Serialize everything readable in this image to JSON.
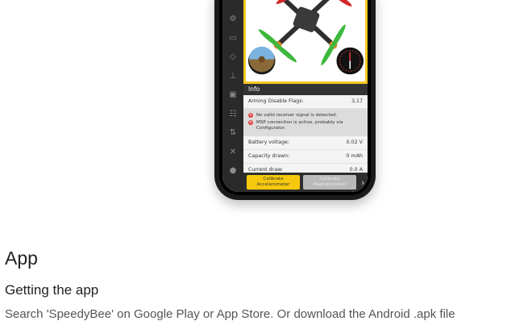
{
  "info": {
    "title": "Info",
    "arming_label": "Arming Disable Flags:",
    "arming_value": "3,17",
    "warnings": [
      "No valid receiver signal is detected.",
      "MSP connection is active, probably via Configurator."
    ],
    "battery_label": "Battery voltage:",
    "battery_value": "0.02 V",
    "capacity_label": "Capacity drawn:",
    "capacity_value": "0 mAh",
    "current_label": "Current draw:",
    "current_value": "0.0 A"
  },
  "buttons": {
    "calibrate_acc": "Calibrate Accelerometer",
    "calibrate_mag": "Calibrate Magnetometer"
  },
  "colors": {
    "accent": "#f6c90e",
    "warning": "#e23c3c",
    "rail": "#2a2a2a"
  },
  "section": {
    "heading": "App",
    "subheading": "Getting the app",
    "paragraph": "Search 'SpeedyBee' on Google Play or App Store. Or download the Android .apk file"
  }
}
